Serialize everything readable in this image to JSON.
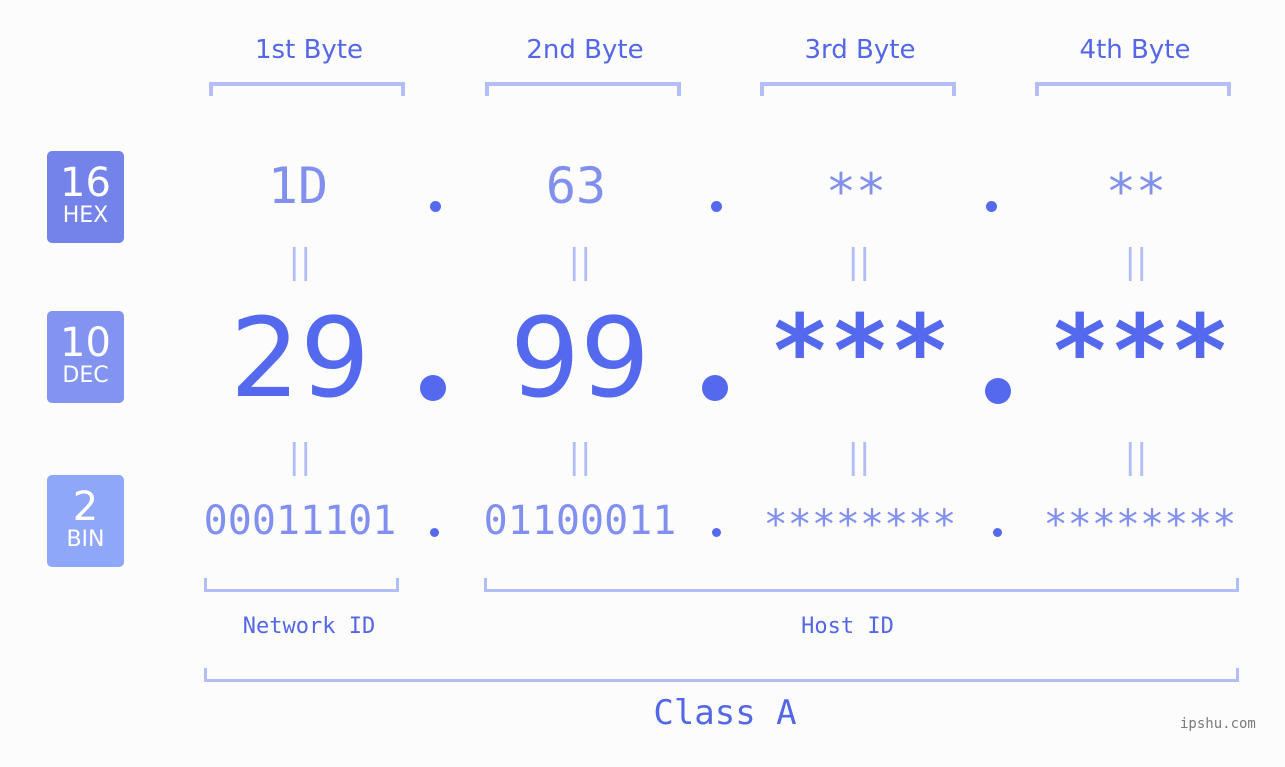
{
  "bytes": [
    {
      "header": "1st Byte",
      "hex": "1D",
      "dec": "29",
      "bin": "00011101"
    },
    {
      "header": "2nd Byte",
      "hex": "63",
      "dec": "99",
      "bin": "01100011"
    },
    {
      "header": "3rd Byte",
      "hex": "**",
      "dec": "***",
      "bin": "********"
    },
    {
      "header": "4th Byte",
      "hex": "**",
      "dec": "***",
      "bin": "********"
    }
  ],
  "badges": {
    "hex": {
      "number": "16",
      "label": "HEX",
      "color": "#7383ea"
    },
    "dec": {
      "number": "10",
      "label": "DEC",
      "color": "#8293f0"
    },
    "bin": {
      "number": "2",
      "label": "BIN",
      "color": "#8fa7f8"
    }
  },
  "equals_sign": "||",
  "segments": {
    "network": "Network ID",
    "host": "Host ID"
  },
  "class_label": "Class A",
  "watermark": "ipshu.com",
  "colors": {
    "accent": "#5469ee",
    "light": "#b3bdf6",
    "hex_text": "#8290ed"
  }
}
